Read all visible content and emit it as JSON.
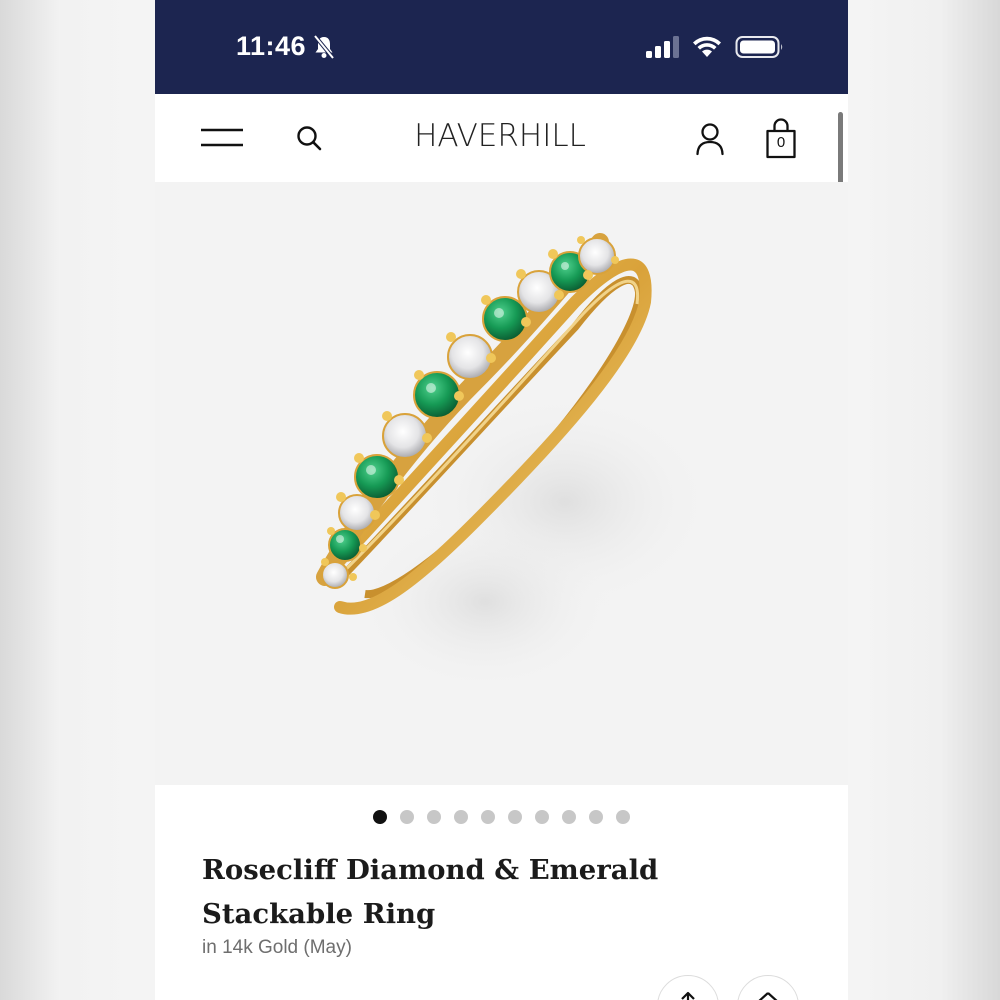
{
  "status_bar": {
    "time": "11:46",
    "icons": [
      "bell-slash-icon",
      "signal-icon",
      "wifi-icon",
      "battery-icon"
    ]
  },
  "header": {
    "logo": "HAVERHILL",
    "cart_count": "0",
    "icons": [
      "hamburger-menu-icon",
      "search-icon",
      "account-icon",
      "shopping-bag-icon"
    ],
    "bar_color": "#1c2550"
  },
  "gallery": {
    "image_description_icon": "ring-image",
    "dot_count": 10,
    "active_index": 0
  },
  "product": {
    "title": "Rosecliff Diamond & Emerald Stackable Ring",
    "variant": "in 14k Gold (May)"
  },
  "actions": {
    "icons": [
      "share-icon",
      "favorite-icon"
    ]
  }
}
